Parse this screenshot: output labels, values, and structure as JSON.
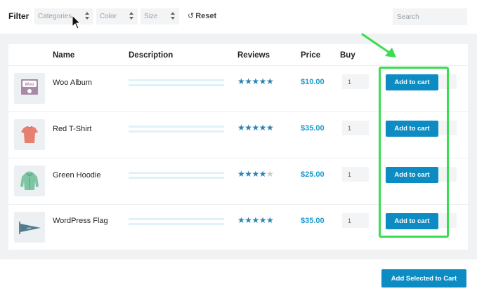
{
  "filter": {
    "label": "Filter",
    "categories_placeholder": "Categories",
    "color_placeholder": "Color",
    "size_placeholder": "Size",
    "reset_label": "Reset",
    "reset_icon": "↺",
    "search_placeholder": "Search"
  },
  "table": {
    "headers": {
      "name": "Name",
      "description": "Description",
      "reviews": "Reviews",
      "price": "Price",
      "buy": "Buy"
    },
    "rows": [
      {
        "name": "Woo Album",
        "price": "$10.00",
        "qty": "1",
        "rating": 4.5,
        "button": "Add to cart",
        "thumb_icon": "woo-album-icon"
      },
      {
        "name": "Red T-Shirt",
        "price": "$35.00",
        "qty": "1",
        "rating": 4.5,
        "button": "Add to cart",
        "thumb_icon": "tshirt-icon"
      },
      {
        "name": "Green Hoodie",
        "price": "$25.00",
        "qty": "1",
        "rating": 4,
        "button": "Add to cart",
        "thumb_icon": "hoodie-icon"
      },
      {
        "name": "WordPress Flag",
        "price": "$35.00",
        "qty": "1",
        "rating": 4.5,
        "button": "Add to cart",
        "thumb_icon": "pennant-flag-icon"
      }
    ]
  },
  "footer": {
    "add_selected_label": "Add Selected to Cart"
  },
  "colors": {
    "accent": "#0d8cc4",
    "price": "#1a9bcf",
    "star": "#2a83b6",
    "highlight": "#3bdc50"
  }
}
